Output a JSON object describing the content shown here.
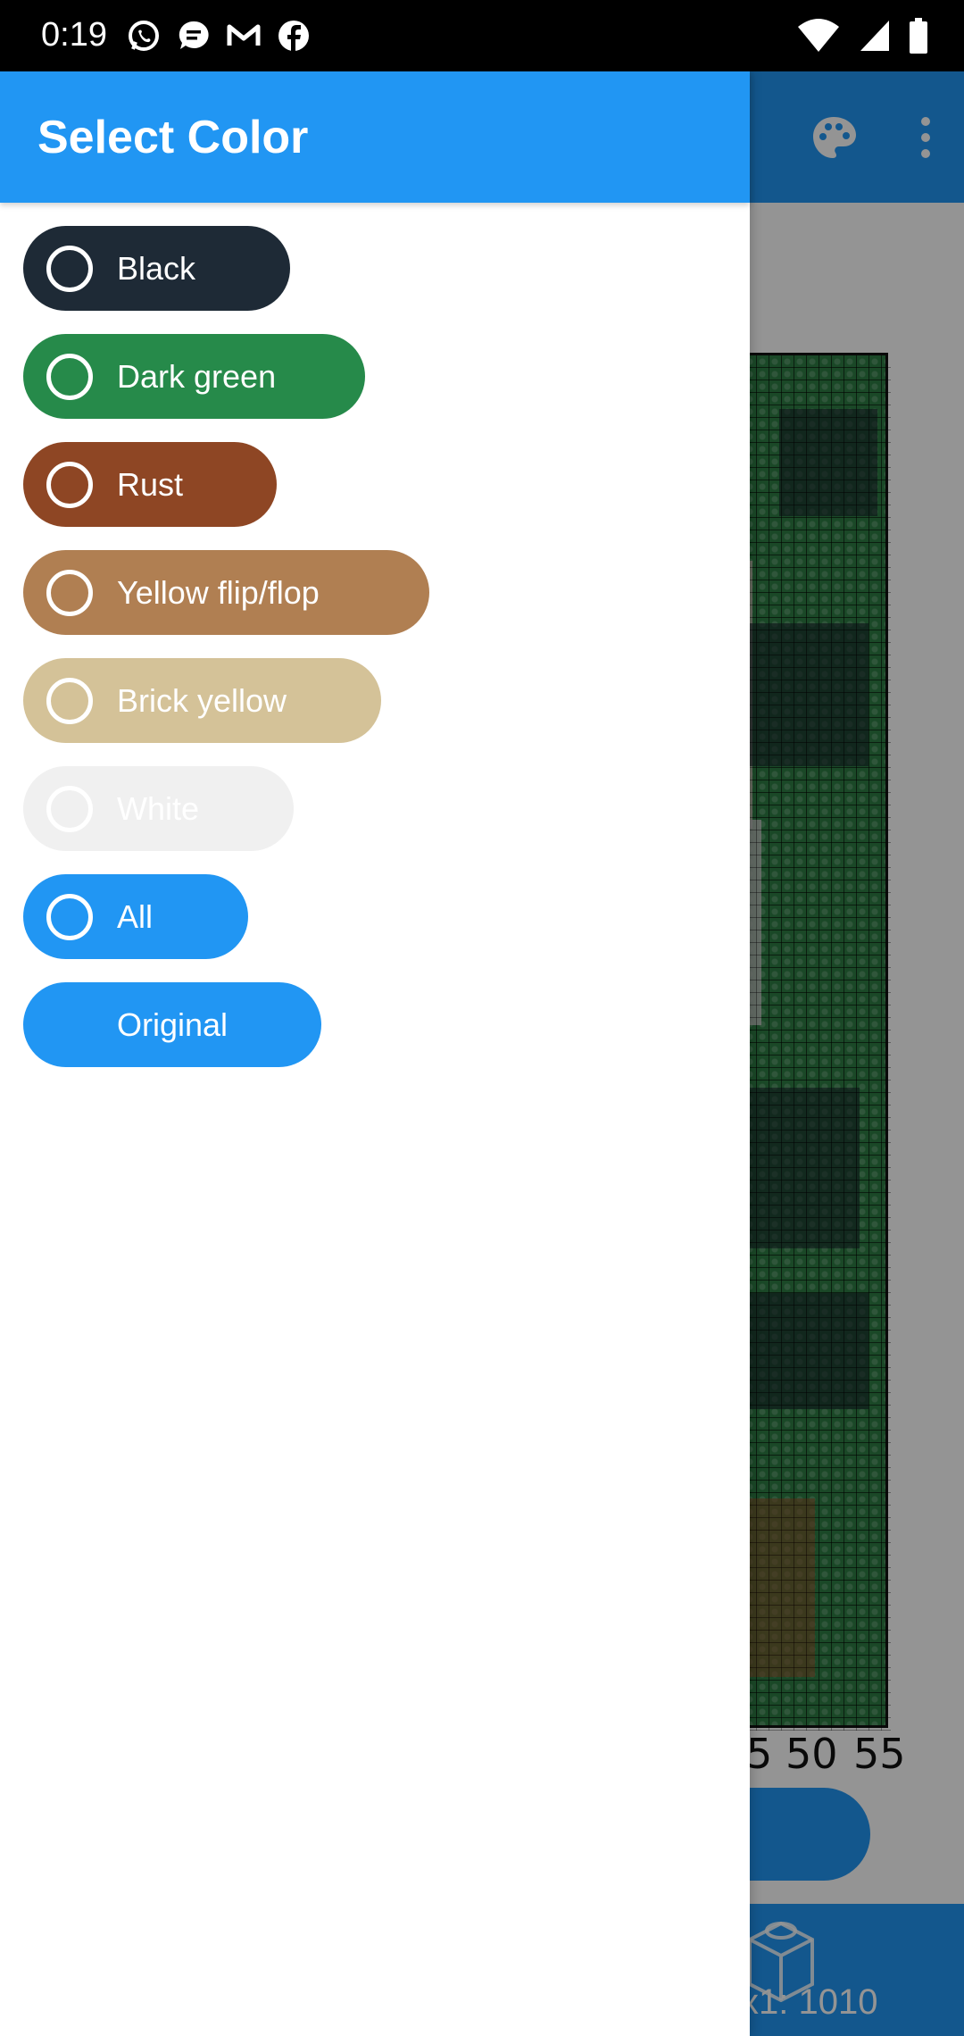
{
  "status_bar": {
    "time": "0:19",
    "left_icons": [
      "whatsapp-icon",
      "messages-icon",
      "gmail-icon",
      "facebook-icon"
    ],
    "right_icons": [
      "wifi-icon",
      "signal-icon",
      "battery-icon"
    ]
  },
  "drawer": {
    "title": "Select Color",
    "accent": "#2196f3",
    "colors": [
      {
        "label": "Black",
        "bg": "#1e2a36"
      },
      {
        "label": "Dark green",
        "bg": "#268a4a"
      },
      {
        "label": "Rust",
        "bg": "#8e4624"
      },
      {
        "label": "Yellow flip/flop",
        "bg": "#b07f52"
      },
      {
        "label": "Brick yellow",
        "bg": "#d4c298"
      },
      {
        "label": "White",
        "bg": "#f0f0f0"
      },
      {
        "label": "All",
        "bg": "#2196f3"
      }
    ],
    "original": {
      "label": "Original",
      "bg": "#2196f3"
    }
  },
  "background_app": {
    "app_bar_icons": [
      "palette-icon",
      "more-vert-icon"
    ],
    "axis_ticks": [
      "5",
      "50",
      "55"
    ],
    "bottom_count": "x1: 1010"
  }
}
